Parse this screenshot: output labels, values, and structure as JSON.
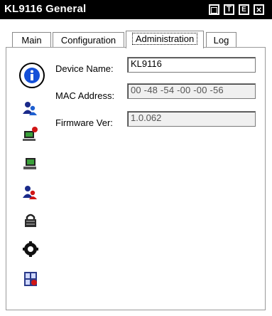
{
  "window": {
    "title": "KL9116 General"
  },
  "titlebar_buttons": [
    {
      "name": "restore",
      "glyph": "▫"
    },
    {
      "name": "help",
      "glyph": "?"
    },
    {
      "name": "exit",
      "glyph": "E"
    },
    {
      "name": "close",
      "glyph": "×"
    }
  ],
  "tabs": [
    {
      "label": "Main"
    },
    {
      "label": "Configuration"
    },
    {
      "label": "Administration"
    },
    {
      "label": "Log"
    }
  ],
  "active_tab": "Administration",
  "sidebar": [
    {
      "icon": "info-icon"
    },
    {
      "icon": "user-admin-icon"
    },
    {
      "icon": "computer-alert-icon"
    },
    {
      "icon": "computer-icon"
    },
    {
      "icon": "user-security-icon"
    },
    {
      "icon": "lock-icon"
    },
    {
      "icon": "gear-icon"
    },
    {
      "icon": "firmware-upgrade-icon"
    }
  ],
  "fields": {
    "device_name": {
      "label": "Device Name:",
      "value": "KL9116"
    },
    "mac_address": {
      "label": "MAC Address:",
      "value": "00 -48 -54 -00 -00 -56"
    },
    "firmware_ver": {
      "label": "Firmware Ver:",
      "value": "1.0.062"
    }
  }
}
